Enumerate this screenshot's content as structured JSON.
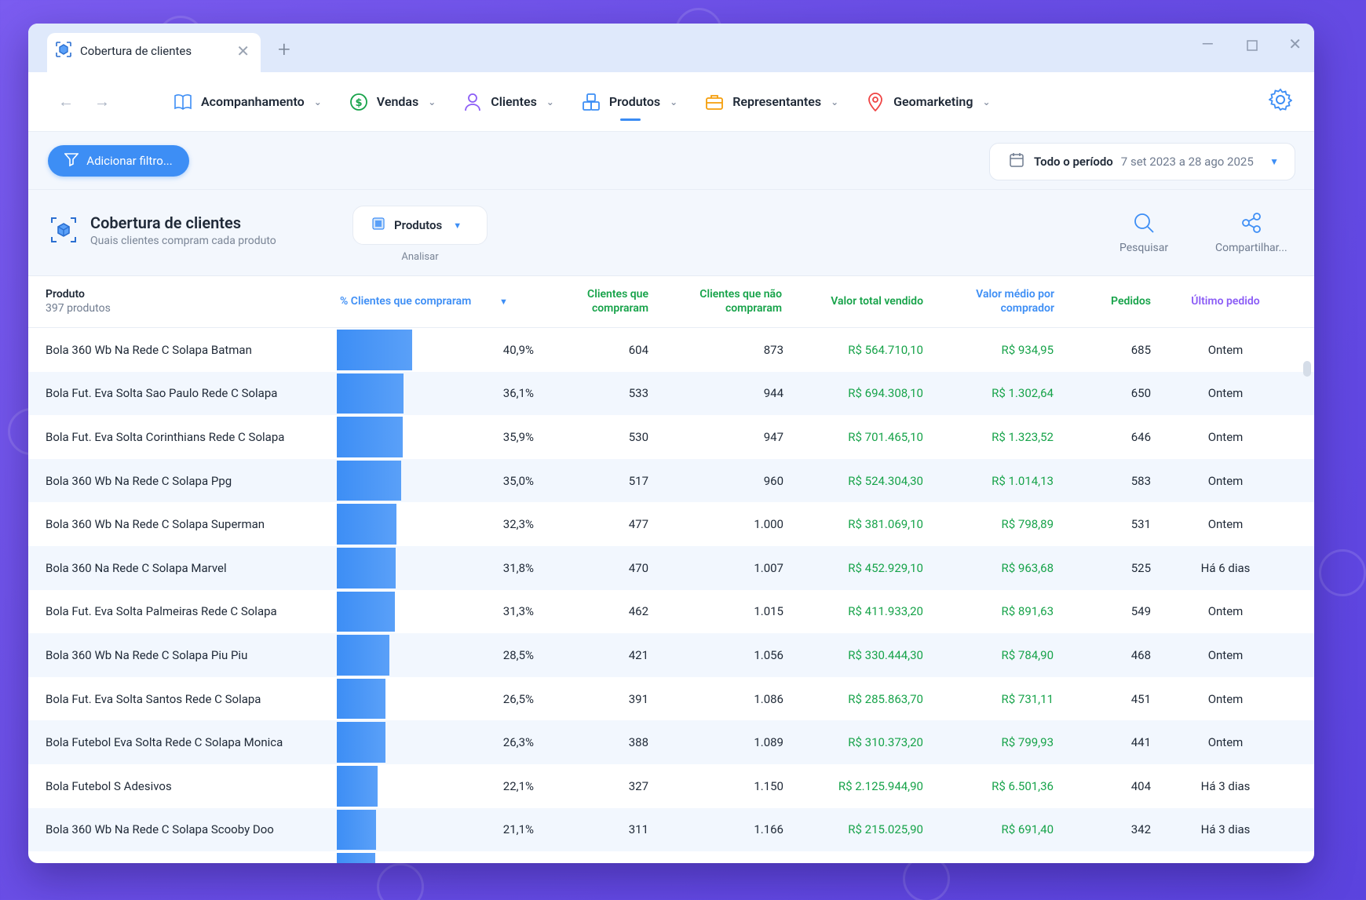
{
  "tab": {
    "title": "Cobertura de clientes"
  },
  "nav": {
    "items": [
      {
        "label": "Acompanhamento"
      },
      {
        "label": "Vendas"
      },
      {
        "label": "Clientes"
      },
      {
        "label": "Produtos"
      },
      {
        "label": "Representantes"
      },
      {
        "label": "Geomarketing"
      }
    ],
    "active": "Produtos"
  },
  "filters": {
    "add_label": "Adicionar filtro...",
    "period_label": "Todo o período",
    "period_range": "7 set 2023 a 28 ago 2025"
  },
  "report": {
    "title": "Cobertura de clientes",
    "subtitle": "Quais clientes compram cada produto",
    "analyze_value": "Produtos",
    "analyze_label": "Analisar",
    "search_label": "Pesquisar",
    "share_label": "Compartilhar..."
  },
  "table": {
    "headers": {
      "produto": "Produto",
      "produto_count": "397 produtos",
      "pct": "% Clientes que compraram",
      "compraram": "Clientes que compraram",
      "nao_compraram": "Clientes que não compraram",
      "valor_total": "Valor total vendido",
      "valor_medio": "Valor médio por comprador",
      "pedidos": "Pedidos",
      "ultimo": "Último pedido"
    },
    "rows": [
      {
        "produto": "Bola 360 Wb Na Rede C  Solapa Batman",
        "pct": "40,9%",
        "pct_value": 40.9,
        "compraram": "604",
        "nao": "873",
        "total": "R$ 564.710,10",
        "medio": "R$ 934,95",
        "pedidos": "685",
        "ultimo": "Ontem"
      },
      {
        "produto": "Bola Fut. Eva Solta Sao Paulo Rede C  Solapa",
        "pct": "36,1%",
        "pct_value": 36.1,
        "compraram": "533",
        "nao": "944",
        "total": "R$ 694.308,10",
        "medio": "R$ 1.302,64",
        "pedidos": "650",
        "ultimo": "Ontem"
      },
      {
        "produto": "Bola Fut. Eva Solta Corinthians Rede C  Solapa",
        "pct": "35,9%",
        "pct_value": 35.9,
        "compraram": "530",
        "nao": "947",
        "total": "R$ 701.465,10",
        "medio": "R$ 1.323,52",
        "pedidos": "646",
        "ultimo": "Ontem"
      },
      {
        "produto": "Bola 360 Wb Na Rede C  Solapa Ppg",
        "pct": "35,0%",
        "pct_value": 35.0,
        "compraram": "517",
        "nao": "960",
        "total": "R$ 524.304,30",
        "medio": "R$ 1.014,13",
        "pedidos": "583",
        "ultimo": "Ontem"
      },
      {
        "produto": "Bola 360 Wb Na Rede C  Solapa Superman",
        "pct": "32,3%",
        "pct_value": 32.3,
        "compraram": "477",
        "nao": "1.000",
        "total": "R$ 381.069,10",
        "medio": "R$ 798,89",
        "pedidos": "531",
        "ultimo": "Ontem"
      },
      {
        "produto": "Bola 360  Na Rede C  Solapa Marvel",
        "pct": "31,8%",
        "pct_value": 31.8,
        "compraram": "470",
        "nao": "1.007",
        "total": "R$ 452.929,10",
        "medio": "R$ 963,68",
        "pedidos": "525",
        "ultimo": "Há 6 dias"
      },
      {
        "produto": "Bola Fut. Eva Solta Palmeiras Rede C  Solapa",
        "pct": "31,3%",
        "pct_value": 31.3,
        "compraram": "462",
        "nao": "1.015",
        "total": "R$ 411.933,20",
        "medio": "R$ 891,63",
        "pedidos": "549",
        "ultimo": "Ontem"
      },
      {
        "produto": "Bola 360 Wb Na Rede C  Solapa Piu Piu",
        "pct": "28,5%",
        "pct_value": 28.5,
        "compraram": "421",
        "nao": "1.056",
        "total": "R$ 330.444,30",
        "medio": "R$ 784,90",
        "pedidos": "468",
        "ultimo": "Ontem"
      },
      {
        "produto": "Bola Fut. Eva Solta Santos Rede C  Solapa",
        "pct": "26,5%",
        "pct_value": 26.5,
        "compraram": "391",
        "nao": "1.086",
        "total": "R$ 285.863,70",
        "medio": "R$ 731,11",
        "pedidos": "451",
        "ultimo": "Ontem"
      },
      {
        "produto": "Bola Futebol Eva Solta Rede C  Solapa Monica",
        "pct": "26,3%",
        "pct_value": 26.3,
        "compraram": "388",
        "nao": "1.089",
        "total": "R$ 310.373,20",
        "medio": "R$ 799,93",
        "pedidos": "441",
        "ultimo": "Ontem"
      },
      {
        "produto": "Bola Futebol S  Adesivos",
        "pct": "22,1%",
        "pct_value": 22.1,
        "compraram": "327",
        "nao": "1.150",
        "total": "R$ 2.125.944,90",
        "medio": "R$ 6.501,36",
        "pedidos": "404",
        "ultimo": "Há 3 dias"
      },
      {
        "produto": "Bola 360 Wb Na Rede C  Solapa Scooby Doo",
        "pct": "21,1%",
        "pct_value": 21.1,
        "compraram": "311",
        "nao": "1.166",
        "total": "R$ 215.025,90",
        "medio": "R$ 691,40",
        "pedidos": "342",
        "ultimo": "Há 3 dias"
      },
      {
        "produto": "",
        "pct": "",
        "pct_value": 21.0,
        "compraram": "",
        "nao": "",
        "total": "",
        "medio": "",
        "pedidos": "",
        "ultimo": ""
      }
    ]
  },
  "colors": {
    "accent": "#3d8ef5",
    "green": "#17a34a",
    "purple": "#8b5cf6",
    "background": "#6a4ee6"
  }
}
